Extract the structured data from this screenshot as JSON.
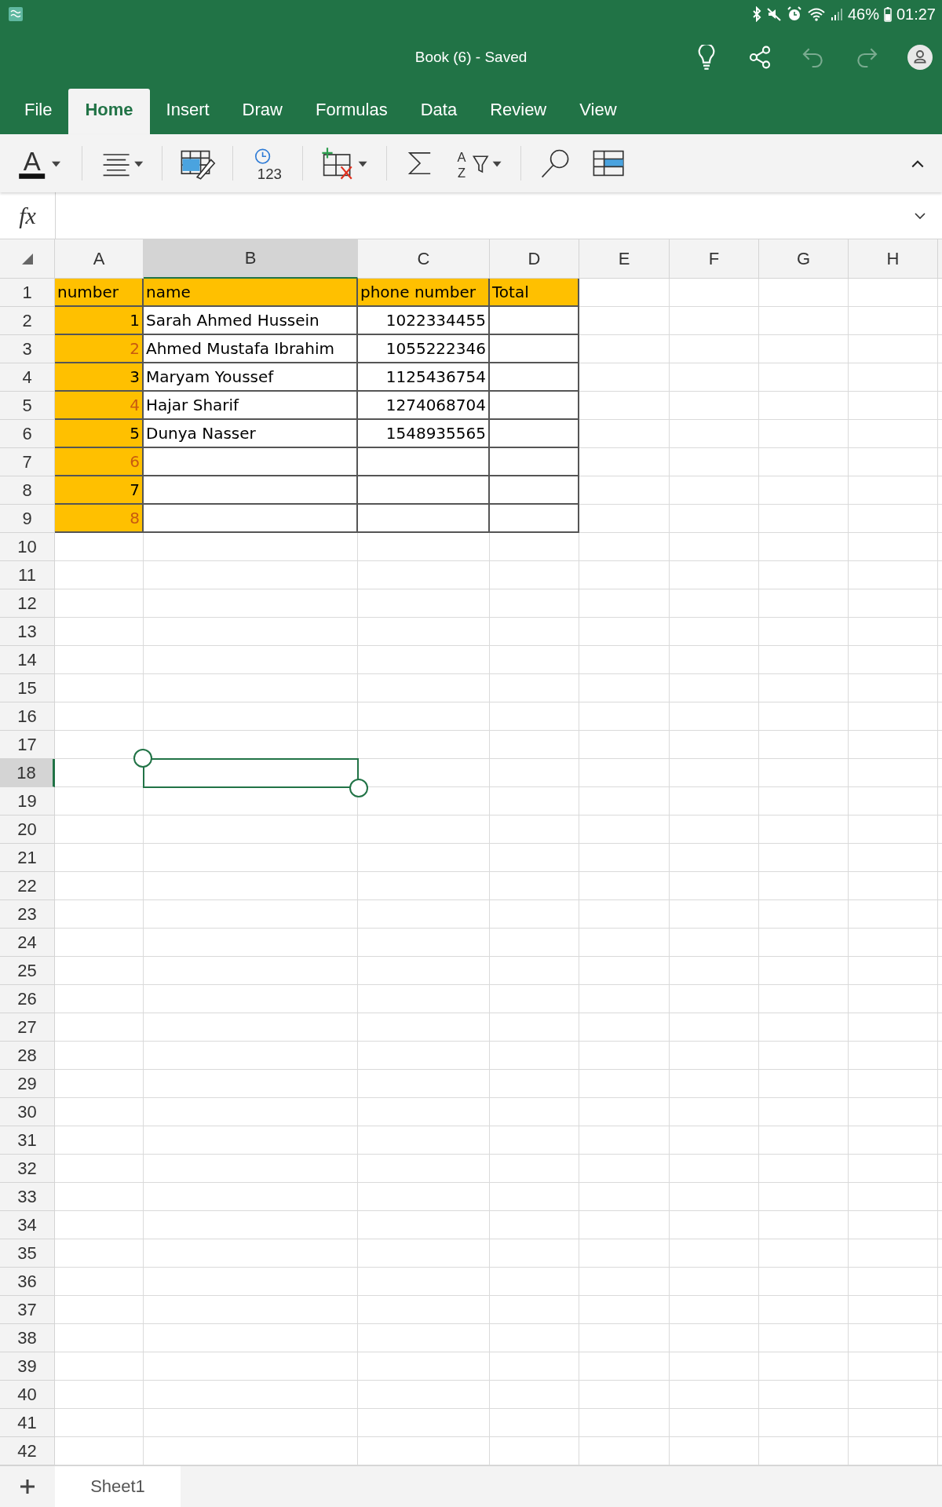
{
  "status_bar": {
    "battery": "46%",
    "time": "01:27"
  },
  "title_bar": {
    "title": "Book (6) - Saved",
    "actions": [
      {
        "kind": "bulb",
        "disabled": false
      },
      {
        "kind": "share",
        "disabled": false
      },
      {
        "kind": "undo",
        "disabled": true
      },
      {
        "kind": "redo",
        "disabled": true
      },
      {
        "kind": "account",
        "disabled": false
      }
    ]
  },
  "tabs": [
    {
      "label": "File",
      "selected": false
    },
    {
      "label": "Home",
      "selected": true
    },
    {
      "label": "Insert",
      "selected": false
    },
    {
      "label": "Draw",
      "selected": false
    },
    {
      "label": "Formulas",
      "selected": false
    },
    {
      "label": "Data",
      "selected": false
    },
    {
      "label": "Review",
      "selected": false
    },
    {
      "label": "View",
      "selected": false
    }
  ],
  "toolbar": [
    {
      "kind": "font-color",
      "glyph": "A"
    },
    {
      "kind": "align"
    },
    {
      "kind": "format"
    },
    {
      "kind": "number",
      "glyph": "123"
    },
    {
      "kind": "insert-delete"
    },
    {
      "kind": "sum"
    },
    {
      "kind": "sort",
      "glyph": "A",
      "glyph2": "Z"
    },
    {
      "kind": "search"
    },
    {
      "kind": "freeze"
    }
  ],
  "formula_bar": {
    "label": "fx"
  },
  "table": {
    "columns": [
      {
        "label": "A",
        "selected": false
      },
      {
        "label": "B",
        "selected": true
      },
      {
        "label": "C",
        "selected": false
      },
      {
        "label": "D",
        "selected": false
      },
      {
        "label": "E",
        "selected": false
      },
      {
        "label": "F",
        "selected": false
      },
      {
        "label": "G",
        "selected": false
      },
      {
        "label": "H",
        "selected": false
      }
    ],
    "row_numbers": [
      {
        "label": "1",
        "selected": false
      },
      {
        "label": "2",
        "selected": false
      },
      {
        "label": "3",
        "selected": false
      },
      {
        "label": "4",
        "selected": false
      },
      {
        "label": "5",
        "selected": false
      },
      {
        "label": "6",
        "selected": false
      },
      {
        "label": "7",
        "selected": false
      },
      {
        "label": "8",
        "selected": false
      },
      {
        "label": "9",
        "selected": false
      },
      {
        "label": "10",
        "selected": false
      },
      {
        "label": "11",
        "selected": false
      },
      {
        "label": "12",
        "selected": false
      },
      {
        "label": "13",
        "selected": false
      },
      {
        "label": "14",
        "selected": false
      },
      {
        "label": "15",
        "selected": false
      },
      {
        "label": "16",
        "selected": false
      },
      {
        "label": "17",
        "selected": false
      },
      {
        "label": "18",
        "selected": true
      },
      {
        "label": "19",
        "selected": false
      },
      {
        "label": "20",
        "selected": false
      },
      {
        "label": "21",
        "selected": false
      },
      {
        "label": "22",
        "selected": false
      },
      {
        "label": "23",
        "selected": false
      },
      {
        "label": "24",
        "selected": false
      },
      {
        "label": "25",
        "selected": false
      },
      {
        "label": "26",
        "selected": false
      },
      {
        "label": "27",
        "selected": false
      },
      {
        "label": "28",
        "selected": false
      },
      {
        "label": "29",
        "selected": false
      },
      {
        "label": "30",
        "selected": false
      },
      {
        "label": "31",
        "selected": false
      },
      {
        "label": "32",
        "selected": false
      },
      {
        "label": "33",
        "selected": false
      },
      {
        "label": "34",
        "selected": false
      },
      {
        "label": "35",
        "selected": false
      },
      {
        "label": "36",
        "selected": false
      },
      {
        "label": "37",
        "selected": false
      },
      {
        "label": "38",
        "selected": false
      },
      {
        "label": "39",
        "selected": false
      },
      {
        "label": "40",
        "selected": false
      },
      {
        "label": "41",
        "selected": false
      },
      {
        "label": "42",
        "selected": false
      }
    ],
    "rows": [
      {
        "cells": [
          {
            "text": "number",
            "kind": "text",
            "highlighted": true
          },
          {
            "text": "name",
            "kind": "text",
            "highlighted": true
          },
          {
            "text": "phone number",
            "kind": "text",
            "highlighted": true
          },
          {
            "text": "Total",
            "kind": "text",
            "highlighted": true
          }
        ]
      },
      {
        "cells": [
          {
            "text": "1",
            "kind": "number",
            "highlighted": true,
            "color": "#000000"
          },
          {
            "text": "Sarah Ahmed Hussein",
            "kind": "text",
            "highlighted": false
          },
          {
            "text": "1022334455",
            "kind": "number",
            "highlighted": false
          },
          {
            "kind": "text",
            "highlighted": false
          }
        ]
      },
      {
        "cells": [
          {
            "text": "2",
            "kind": "number",
            "highlighted": true,
            "color": "#c85a10"
          },
          {
            "text": "Ahmed Mustafa Ibrahim",
            "kind": "text",
            "highlighted": false
          },
          {
            "text": "1055222346",
            "kind": "number",
            "highlighted": false
          },
          {
            "kind": "text",
            "highlighted": false
          }
        ]
      },
      {
        "cells": [
          {
            "text": "3",
            "kind": "number",
            "highlighted": true,
            "color": "#000000"
          },
          {
            "text": "Maryam Youssef",
            "kind": "text",
            "highlighted": false
          },
          {
            "text": "1125436754",
            "kind": "number",
            "highlighted": false
          },
          {
            "kind": "text",
            "highlighted": false
          }
        ]
      },
      {
        "cells": [
          {
            "text": "4",
            "kind": "number",
            "highlighted": true,
            "color": "#c85a10"
          },
          {
            "text": "Hajar Sharif",
            "kind": "text",
            "highlighted": false
          },
          {
            "text": "1274068704",
            "kind": "number",
            "highlighted": false
          },
          {
            "kind": "text",
            "highlighted": false
          }
        ]
      },
      {
        "cells": [
          {
            "text": "5",
            "kind": "number",
            "highlighted": true,
            "color": "#000000"
          },
          {
            "text": "Dunya Nasser",
            "kind": "text",
            "highlighted": false
          },
          {
            "text": "1548935565",
            "kind": "number",
            "highlighted": false
          },
          {
            "kind": "text",
            "highlighted": false
          }
        ]
      },
      {
        "cells": [
          {
            "text": "6",
            "kind": "number",
            "highlighted": true,
            "color": "#c85a10"
          },
          {
            "kind": "text",
            "highlighted": false
          },
          {
            "kind": "text",
            "highlighted": false
          },
          {
            "kind": "text",
            "highlighted": false
          }
        ]
      },
      {
        "cells": [
          {
            "text": "7",
            "kind": "number",
            "highlighted": true,
            "color": "#000000"
          },
          {
            "kind": "text",
            "highlighted": false
          },
          {
            "kind": "text",
            "highlighted": false
          },
          {
            "kind": "text",
            "highlighted": false
          }
        ]
      },
      {
        "cells": [
          {
            "text": "8",
            "kind": "number",
            "highlighted": true,
            "color": "#c85a10"
          },
          {
            "kind": "text",
            "highlighted": false
          },
          {
            "kind": "text",
            "highlighted": false
          },
          {
            "kind": "text",
            "highlighted": false
          }
        ]
      }
    ]
  },
  "sheet_tabs": [
    {
      "label": "Sheet1",
      "selected": true
    }
  ]
}
